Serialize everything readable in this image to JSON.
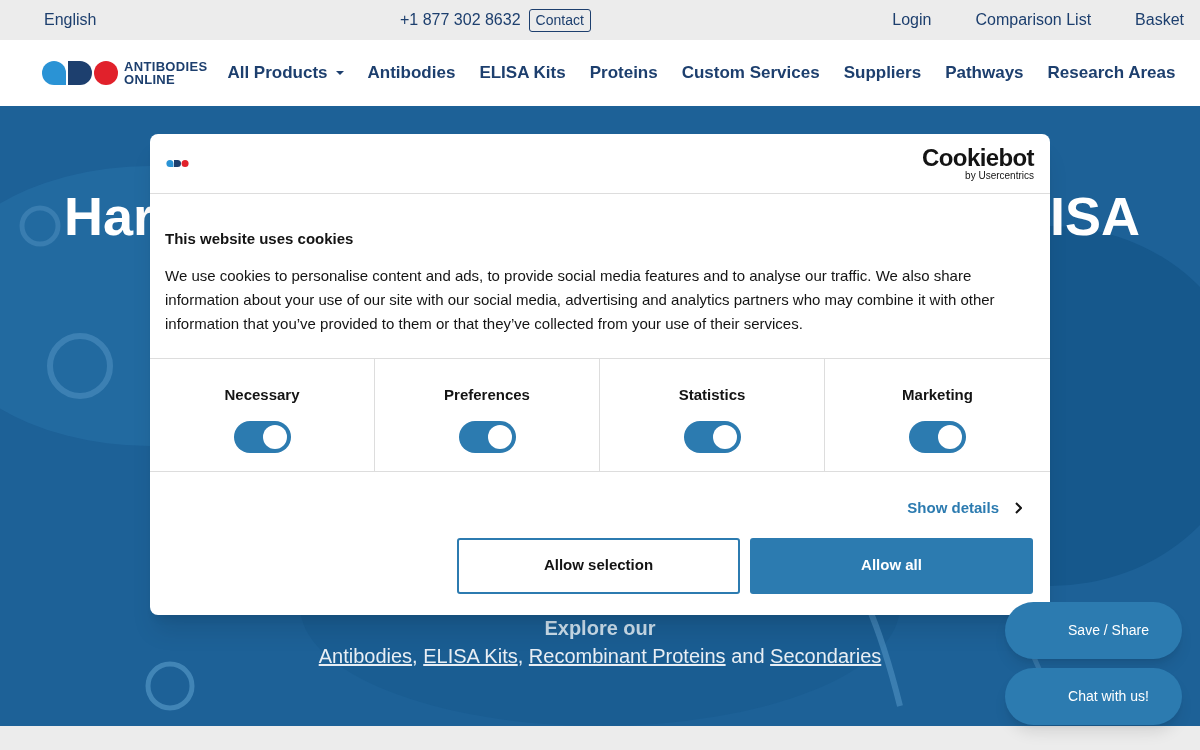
{
  "top_bar": {
    "language": "English",
    "phone": "+1 877 302 8632",
    "contact": "Contact",
    "links": [
      "Login",
      "Comparison List",
      "Basket"
    ]
  },
  "nav": {
    "logo": {
      "line1": "ANTIBODIES",
      "line2": "ONLINE"
    },
    "items": [
      {
        "label": "All Products",
        "dropdown": true
      },
      {
        "label": "Antibodies",
        "dropdown": false
      },
      {
        "label": "ELISA Kits",
        "dropdown": false
      },
      {
        "label": "Proteins",
        "dropdown": false
      },
      {
        "label": "Custom Services",
        "dropdown": false
      },
      {
        "label": "Suppliers",
        "dropdown": false
      },
      {
        "label": "Pathways",
        "dropdown": false
      },
      {
        "label": "Research Areas",
        "dropdown": false
      }
    ]
  },
  "hero": {
    "heading_left": "Har",
    "heading_right": "ISA",
    "explore": "Explore our",
    "links": [
      {
        "text": "Antibodies",
        "sep": ", "
      },
      {
        "text": "ELISA Kits",
        "sep": ", "
      },
      {
        "text": "Recombinant Proteins",
        "sep": " and "
      },
      {
        "text": "Secondaries"
      }
    ]
  },
  "cookie_dialog": {
    "brand": "Cookiebot",
    "brand_sub": "by Usercentrics",
    "title": "This website uses cookies",
    "text": "We use cookies to personalise content and ads, to provide social media features and to analyse our traffic. We also share information about your use of our site with our social media, advertising and analytics partners who may combine it with other information that you’ve provided to them or that they’ve collected from your use of their services.",
    "categories": [
      {
        "label": "Necessary",
        "on": true
      },
      {
        "label": "Preferences",
        "on": true
      },
      {
        "label": "Statistics",
        "on": true
      },
      {
        "label": "Marketing",
        "on": true
      }
    ],
    "show_details": "Show details",
    "buttons": [
      {
        "label": "Allow selection",
        "kind": "outline"
      },
      {
        "label": "Allow all",
        "kind": "primary"
      }
    ]
  },
  "floating": [
    {
      "label": "Save / Share"
    },
    {
      "label": "Chat with us!"
    }
  ]
}
